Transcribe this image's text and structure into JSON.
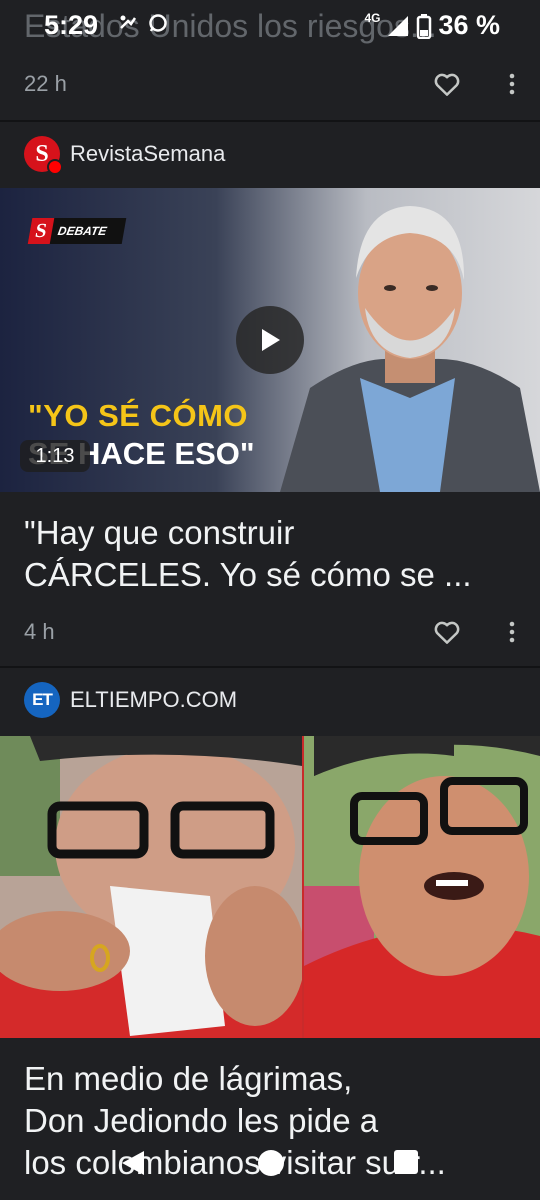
{
  "status_bar": {
    "time": "5:29",
    "network": "4G",
    "battery": "36 %"
  },
  "prev_card": {
    "title": "Estados Unidos los riesgos...",
    "time": "22 h"
  },
  "card1": {
    "source": "RevistaSemana",
    "overlay_tag": "DEBATE",
    "overlay_quote_line1": "\"YO SÉ CÓMO",
    "overlay_quote_line2": "SE HACE ESO\"",
    "duration": "1:13",
    "headline_line1": "\"Hay que construir",
    "headline_line2": "CÁRCELES. Yo sé cómo se ...",
    "time": "4 h"
  },
  "card2": {
    "source": "ELTIEMPO.COM",
    "headline_line1": "En medio de lágrimas,",
    "headline_line2": "Don Jediondo les pide a",
    "headline_line3": "los colombianos visitar su r..."
  },
  "icons": {
    "heart": "heart-icon",
    "more": "more-vert-icon",
    "play": "play-icon",
    "back": "back-icon",
    "home": "home-icon",
    "recents": "recents-icon"
  },
  "colors": {
    "background": "#1f2023",
    "text": "#e8eaed",
    "muted": "#9aa0a6",
    "semana_red": "#d6121b",
    "eltiempo_blue": "#1565c0",
    "quote_yellow": "#f5c518"
  }
}
